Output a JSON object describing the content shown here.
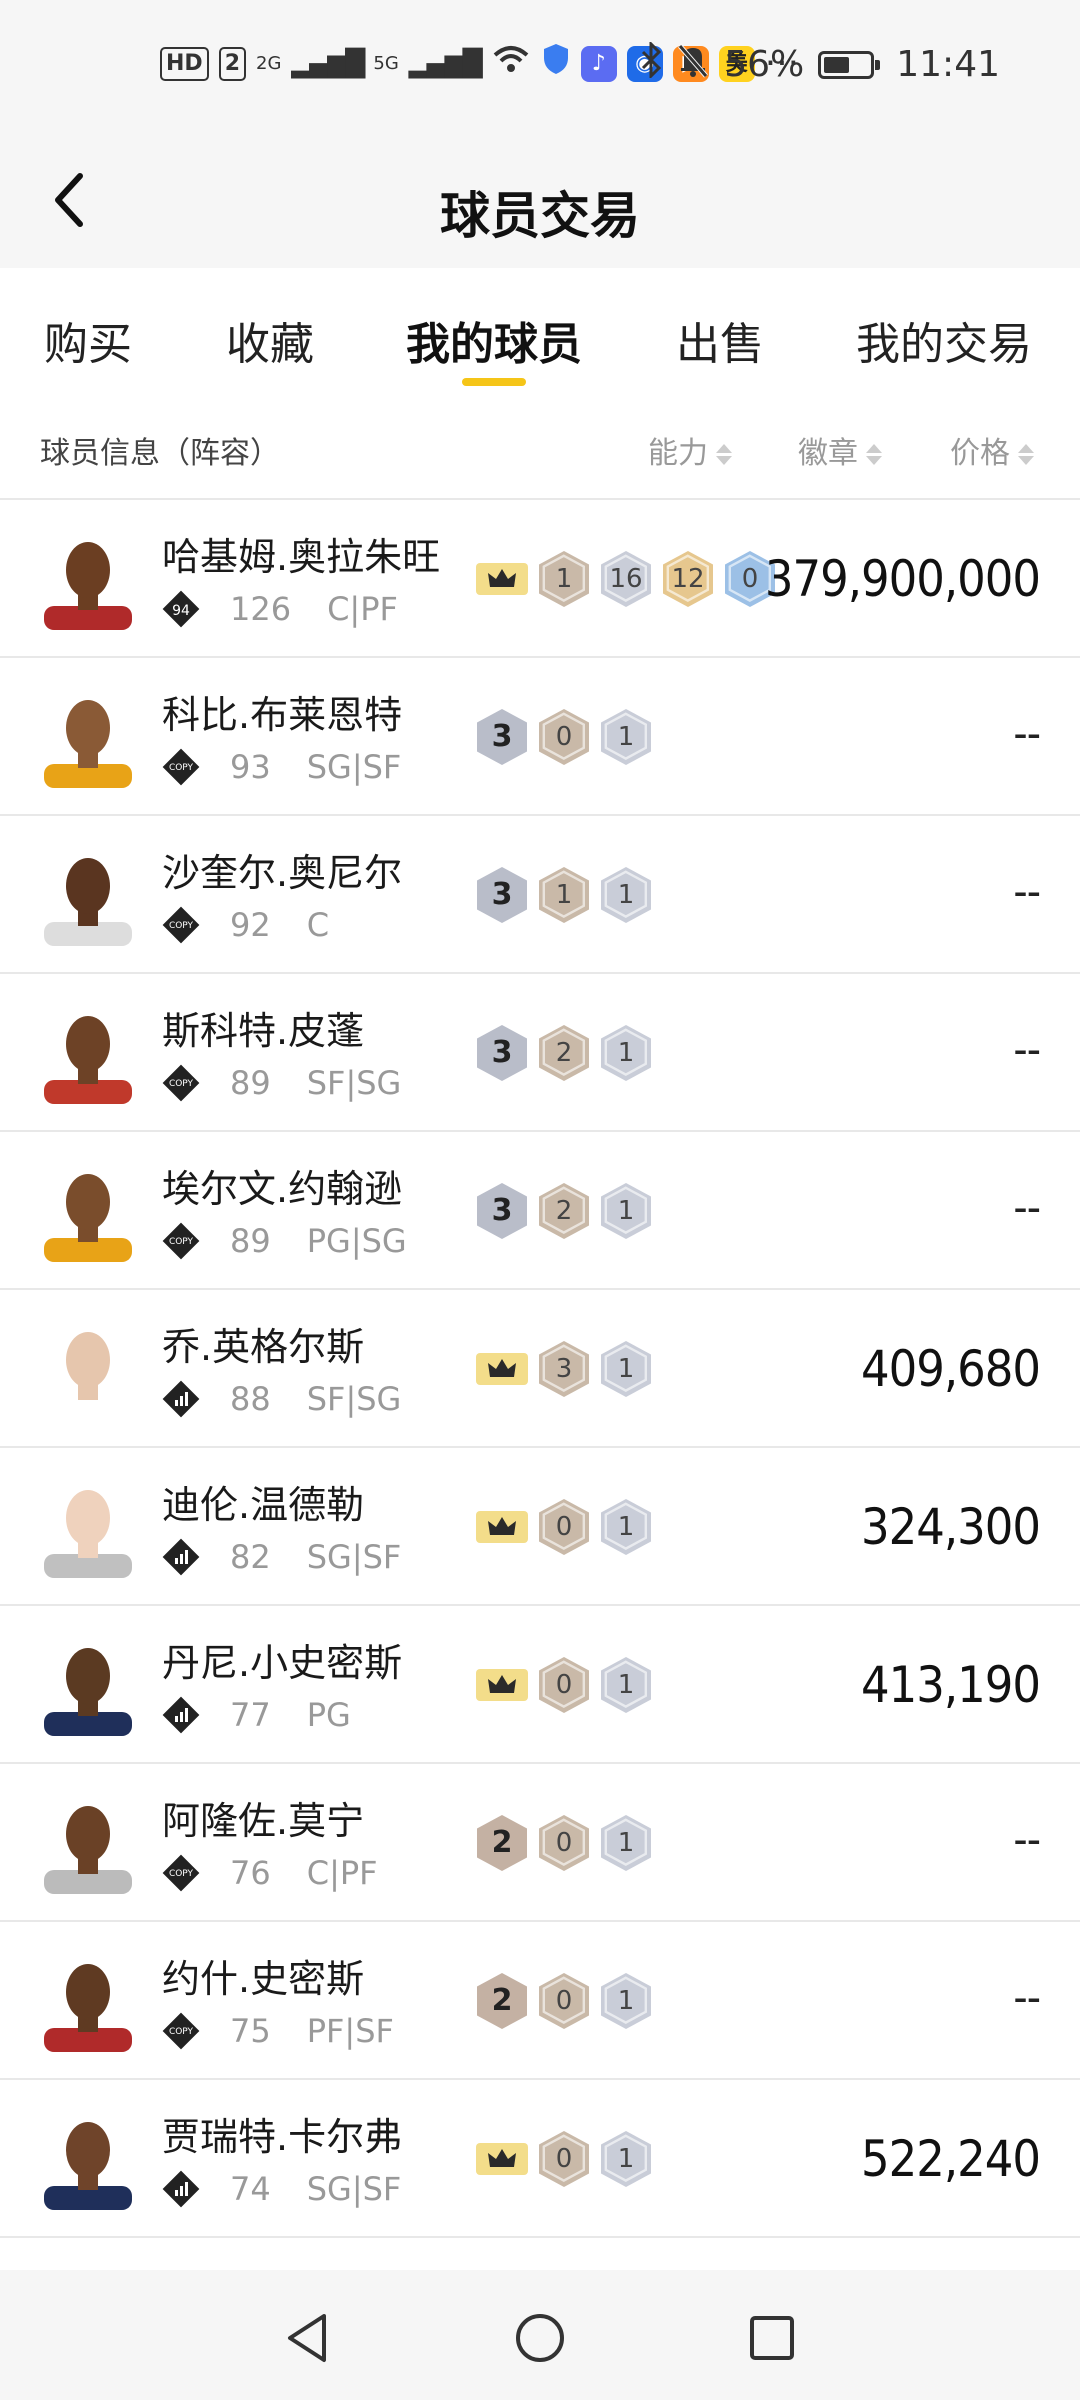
{
  "status_bar": {
    "net_chip": "HD",
    "sim_chip": "2",
    "signal_1": "2G",
    "signal_2": "5G",
    "app_mei": "美",
    "more": "···",
    "battery": "56%",
    "time": "11:41",
    "battery_level": 0.56
  },
  "header": {
    "title": "球员交易"
  },
  "tabs": [
    {
      "label": "购买"
    },
    {
      "label": "收藏"
    },
    {
      "label": "我的球员",
      "active": true
    },
    {
      "label": "出售"
    },
    {
      "label": "我的交易"
    }
  ],
  "list_header": {
    "info": "球员信息（阵容）",
    "ability": "能力",
    "badges": "徽章",
    "price": "价格"
  },
  "players": [
    {
      "name": "哈基姆.奥拉朱旺",
      "tier": "94",
      "tier_type": "94",
      "rating": "126",
      "position": "C|PF",
      "rank": "crown",
      "badges": [
        "1",
        "16",
        "12",
        "0"
      ],
      "badge_colors": [
        "bronze",
        "silver",
        "gold",
        "blue"
      ],
      "price": "379,900,000"
    },
    {
      "name": "科比.布莱恩特",
      "tier": "COPY",
      "tier_type": "copy",
      "rating": "93",
      "position": "SG|SF",
      "rank": "3",
      "badges": [
        "0",
        "1"
      ],
      "badge_colors": [
        "bronze",
        "silver"
      ],
      "price": "--"
    },
    {
      "name": "沙奎尔.奥尼尔",
      "tier": "COPY",
      "tier_type": "copy",
      "rating": "92",
      "position": "C",
      "rank": "3",
      "badges": [
        "1",
        "1"
      ],
      "badge_colors": [
        "bronze",
        "silver"
      ],
      "price": "--"
    },
    {
      "name": "斯科特.皮蓬",
      "tier": "COPY",
      "tier_type": "copy",
      "rating": "89",
      "position": "SF|SG",
      "rank": "3",
      "badges": [
        "2",
        "1"
      ],
      "badge_colors": [
        "bronze",
        "silver"
      ],
      "price": "--"
    },
    {
      "name": "埃尔文.约翰逊",
      "tier": "COPY",
      "tier_type": "copy",
      "rating": "89",
      "position": "PG|SG",
      "rank": "3",
      "badges": [
        "2",
        "1"
      ],
      "badge_colors": [
        "bronze",
        "silver"
      ],
      "price": "--"
    },
    {
      "name": "乔.英格尔斯",
      "tier": "bars",
      "tier_type": "bars",
      "rating": "88",
      "position": "SF|SG",
      "rank": "crown",
      "badges": [
        "3",
        "1"
      ],
      "badge_colors": [
        "bronze",
        "silver"
      ],
      "price": "409,680"
    },
    {
      "name": "迪伦.温德勒",
      "tier": "bars",
      "tier_type": "bars",
      "rating": "82",
      "position": "SG|SF",
      "rank": "crown",
      "badges": [
        "0",
        "1"
      ],
      "badge_colors": [
        "bronze",
        "silver"
      ],
      "price": "324,300"
    },
    {
      "name": "丹尼.小史密斯",
      "tier": "bars",
      "tier_type": "bars",
      "rating": "77",
      "position": "PG",
      "rank": "crown",
      "badges": [
        "0",
        "1"
      ],
      "badge_colors": [
        "bronze",
        "silver"
      ],
      "price": "413,190"
    },
    {
      "name": "阿隆佐.莫宁",
      "tier": "COPY",
      "tier_type": "copy",
      "rating": "76",
      "position": "C|PF",
      "rank": "2",
      "badges": [
        "0",
        "1"
      ],
      "badge_colors": [
        "bronze",
        "silver"
      ],
      "price": "--"
    },
    {
      "name": "约什.史密斯",
      "tier": "COPY",
      "tier_type": "copy",
      "rating": "75",
      "position": "PF|SF",
      "rank": "2",
      "badges": [
        "0",
        "1"
      ],
      "badge_colors": [
        "bronze",
        "silver"
      ],
      "price": "--"
    },
    {
      "name": "贾瑞特.卡尔弗",
      "tier": "bars",
      "tier_type": "bars",
      "rating": "74",
      "position": "SG|SF",
      "rank": "crown",
      "badges": [
        "0",
        "1"
      ],
      "badge_colors": [
        "bronze",
        "silver"
      ],
      "price": "522,240"
    }
  ],
  "colors": {
    "accent": "#f5c518",
    "crown_bg": "#f3dd8a",
    "bronze": "#c9b9a8",
    "silver": "#c9cdd8",
    "gold": "#e6c78e",
    "blue": "#9cc0e6",
    "rank3": "#b9bdc9",
    "rank2": "#c4b1a3"
  }
}
